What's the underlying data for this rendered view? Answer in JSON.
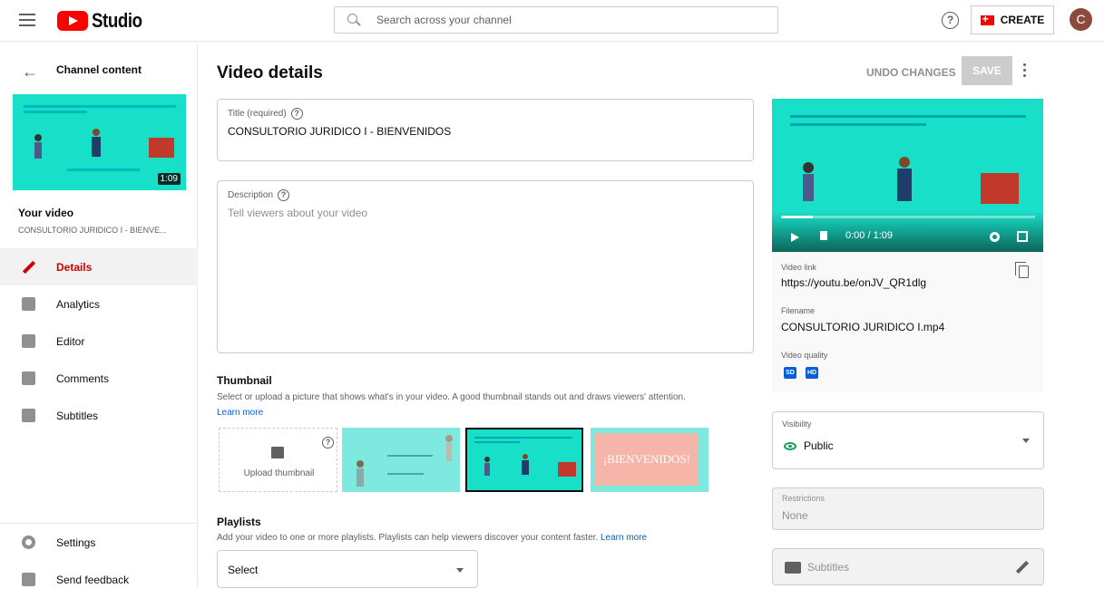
{
  "header": {
    "logo_text": "Studio",
    "search_placeholder": "Search across your channel",
    "create_label": "CREATE",
    "avatar_letter": "C"
  },
  "sidebar": {
    "back_label": "Channel content",
    "thumbnail_duration": "1:09",
    "your_video_heading": "Your video",
    "your_video_title": "CONSULTORIO JURIDICO I - BIENVE...",
    "nav": [
      {
        "label": "Details",
        "icon": "pencil-icon",
        "active": true
      },
      {
        "label": "Analytics",
        "icon": "analytics-icon"
      },
      {
        "label": "Editor",
        "icon": "editor-icon"
      },
      {
        "label": "Comments",
        "icon": "comments-icon"
      },
      {
        "label": "Subtitles",
        "icon": "subtitles-icon"
      }
    ],
    "bottom": [
      {
        "label": "Settings",
        "icon": "gear-icon"
      },
      {
        "label": "Send feedback",
        "icon": "feedback-icon"
      }
    ]
  },
  "main": {
    "title": "Video details",
    "undo_label": "UNDO CHANGES",
    "save_label": "SAVE",
    "title_field": {
      "label": "Title (required)",
      "value": "CONSULTORIO JURIDICO I - BIENVENIDOS"
    },
    "description_field": {
      "label": "Description",
      "placeholder": "Tell viewers about your video"
    },
    "thumbnail": {
      "heading": "Thumbnail",
      "text": "Select or upload a picture that shows what's in your video. A good thumbnail stands out and draws viewers' attention.",
      "learn_more": "Learn more",
      "upload_label": "Upload thumbnail",
      "option3_text": "¡BIENVENIDOS!"
    },
    "playlists": {
      "heading": "Playlists",
      "text": "Add your video to one or more playlists. Playlists can help viewers discover your content faster.",
      "learn_more": "Learn more",
      "select_value": "Select"
    }
  },
  "right": {
    "player_time": "0:00 / 1:09",
    "video_link_label": "Video link",
    "video_link": "https://youtu.be/onJV_QR1dlg",
    "filename_label": "Filename",
    "filename": "CONSULTORIO JURIDICO I.mp4",
    "quality_label": "Video quality",
    "quality_badges": [
      "SD",
      "HD"
    ],
    "visibility_label": "Visibility",
    "visibility_value": "Public",
    "restrictions_label": "Restrictions",
    "restrictions_value": "None",
    "subtitles_label": "Subtitles"
  },
  "colors": {
    "accent": "#cc0000",
    "brand": "#ff0000",
    "link": "#065fd4",
    "teal": "#18e0c8",
    "public": "#0f9d58"
  }
}
